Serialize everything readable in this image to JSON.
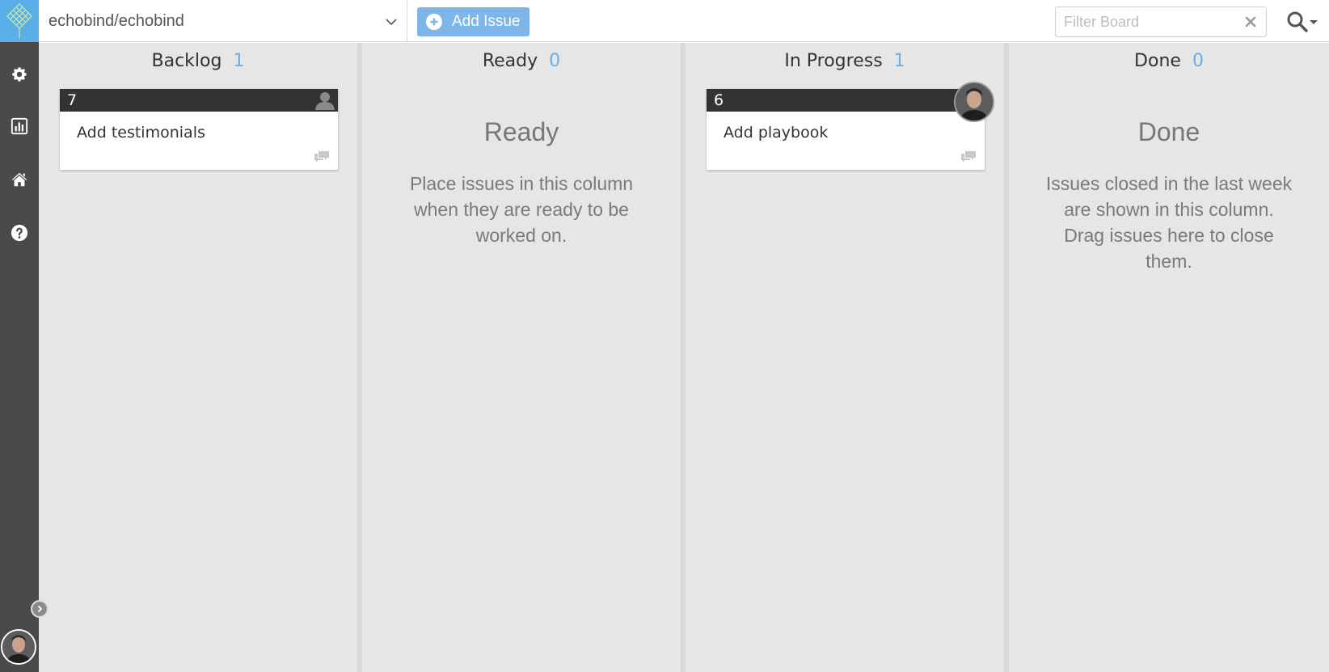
{
  "app": {
    "logo_icon": "kanban-diamond-logo",
    "accent": "#5ab0e6"
  },
  "sidebar": {
    "items": [
      {
        "name": "settings",
        "icon": "gear-icon"
      },
      {
        "name": "reports",
        "icon": "bar-chart-icon"
      },
      {
        "name": "home",
        "icon": "home-icon"
      },
      {
        "name": "help",
        "icon": "question-circle-icon"
      }
    ],
    "collapse_icon": "chevron-right-icon"
  },
  "header": {
    "repo": "echobind/echobind",
    "add_issue_label": "Add Issue",
    "filter_placeholder": "Filter Board",
    "add_issue_color": "#7eb6ea"
  },
  "columns": [
    {
      "title": "Backlog",
      "count": "1",
      "cards": [
        {
          "number": "7",
          "title": "Add testimonials",
          "assignee": "unassigned"
        }
      ]
    },
    {
      "title": "Ready",
      "count": "0",
      "placeholder_title": "Ready",
      "placeholder_text": "Place issues in this column when they are ready to be worked on."
    },
    {
      "title": "In Progress",
      "count": "1",
      "cards": [
        {
          "number": "6",
          "title": "Add playbook",
          "assignee": "user-avatar"
        }
      ]
    },
    {
      "title": "Done",
      "count": "0",
      "placeholder_title": "Done",
      "placeholder_text": "Issues closed in the last week are shown in this column. Drag issues here to close them."
    }
  ],
  "count_color": "#6aaee8"
}
